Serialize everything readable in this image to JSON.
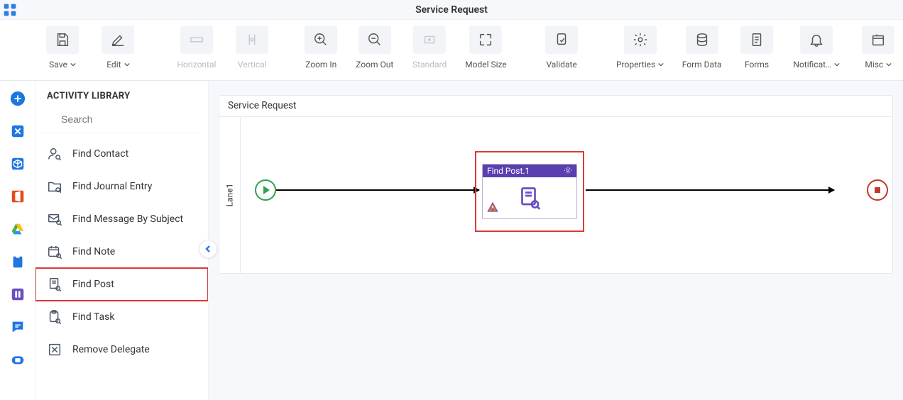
{
  "header": {
    "title": "Service Request"
  },
  "toolbar": {
    "save": "Save",
    "edit": "Edit",
    "horizontal": "Horizontal",
    "vertical": "Vertical",
    "zoom_in": "Zoom In",
    "zoom_out": "Zoom Out",
    "standard": "Standard",
    "model_size": "Model Size",
    "validate": "Validate",
    "properties": "Properties",
    "form_data": "Form Data",
    "forms": "Forms",
    "notifications": "Notificat…",
    "misc": "Misc"
  },
  "library": {
    "heading": "ACTIVITY LIBRARY",
    "search_placeholder": "Search",
    "items": [
      {
        "label": "Find Contact",
        "icon": "contact-search"
      },
      {
        "label": "Find Journal Entry",
        "icon": "folder-search"
      },
      {
        "label": "Find Message By Subject",
        "icon": "mail-search"
      },
      {
        "label": "Find Note",
        "icon": "calendar-search"
      },
      {
        "label": "Find Post",
        "icon": "doc-search"
      },
      {
        "label": "Find Task",
        "icon": "clipboard-search"
      },
      {
        "label": "Remove Delegate",
        "icon": "remove-box"
      }
    ],
    "highlighted_index": 4
  },
  "canvas": {
    "title": "Service Request",
    "lane": "Lane1",
    "activity_node": {
      "title": "Find Post.1",
      "has_warning": true
    }
  }
}
